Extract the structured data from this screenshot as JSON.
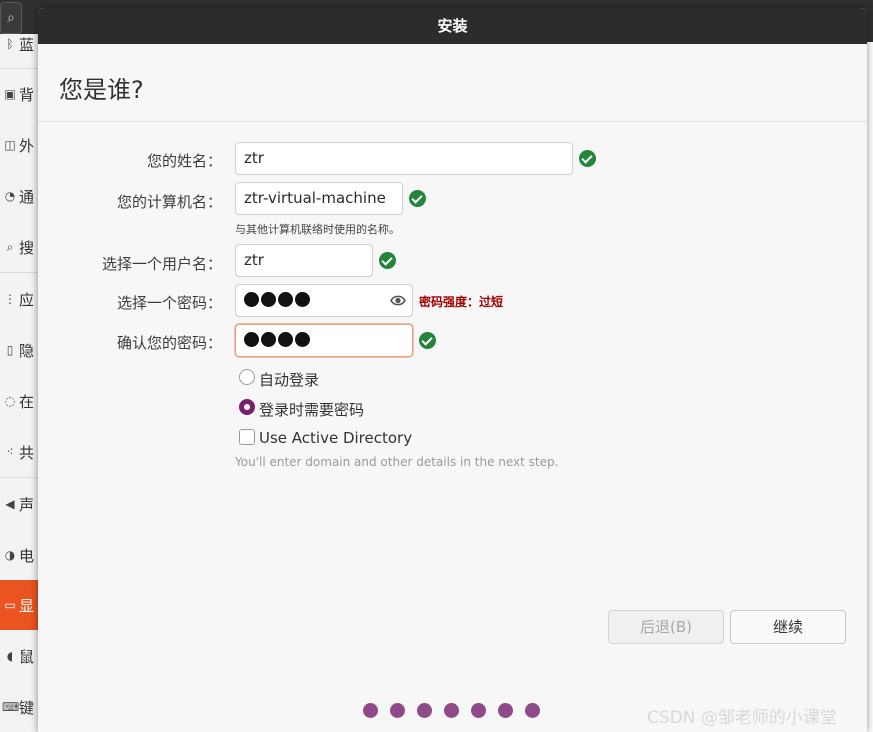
{
  "background_app": {
    "search_icon": "search-icon",
    "items": [
      {
        "label": "蓝",
        "icon": "bluetooth-icon"
      },
      {
        "label": "背",
        "icon": "background-icon"
      },
      {
        "label": "外",
        "icon": "appearance-icon"
      },
      {
        "label": "通",
        "icon": "notifications-icon"
      },
      {
        "label": "搜",
        "icon": "search-icon"
      },
      {
        "label": "应",
        "icon": "applications-icon"
      },
      {
        "label": "隐",
        "icon": "privacy-icon"
      },
      {
        "label": "在",
        "icon": "online-accounts-icon"
      },
      {
        "label": "共",
        "icon": "sharing-icon"
      },
      {
        "label": "声",
        "icon": "sound-icon"
      },
      {
        "label": "电",
        "icon": "power-icon"
      },
      {
        "label": "显",
        "icon": "display-icon"
      },
      {
        "label": "鼠",
        "icon": "mouse-icon"
      },
      {
        "label": "键",
        "icon": "keyboard-icon"
      }
    ],
    "active_index": 11,
    "accent": "#e95420"
  },
  "window": {
    "title": "安装"
  },
  "page": {
    "heading": "您是谁?"
  },
  "form": {
    "name": {
      "label": "您的姓名：",
      "value": "ztr"
    },
    "computer": {
      "label": "您的计算机名：",
      "value": "ztr-virtual-machine",
      "hint": "与其他计算机联络时使用的名称。"
    },
    "username": {
      "label": "选择一个用户名：",
      "value": "ztr"
    },
    "password": {
      "label": "选择一个密码：",
      "strength": "密码强度：过短",
      "masked_length": 4
    },
    "confirm": {
      "label": "确认您的密码：",
      "masked_length": 4
    }
  },
  "options": {
    "auto_login": "自动登录",
    "require_password": "登录时需要密码",
    "selected": "require_password",
    "active_directory": "Use Active Directory",
    "ad_note": "You'll enter domain and other details in the next step."
  },
  "buttons": {
    "back": "后退(B)",
    "continue": "继续"
  },
  "progress": {
    "total_steps": 7,
    "color": "#8f4b89"
  },
  "watermark": "CSDN @邹老师的小课堂",
  "colors": {
    "check": "#23853b",
    "strength_warning": "#a40000",
    "radio_selected": "#77216f"
  }
}
